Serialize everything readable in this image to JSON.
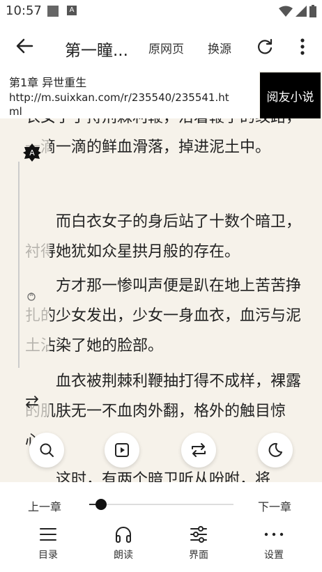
{
  "status": {
    "time": "10:57",
    "a_icon": "A"
  },
  "appbar": {
    "title": "第一瞳...",
    "original_page": "原网页",
    "change_source": "换源"
  },
  "info": {
    "chapter": "第1章 异世重生",
    "url": "http://m.suixkan.com/r/235540/235541.html",
    "source_name": "阅友小说"
  },
  "reader": {
    "paragraphs": [
      "衣女子手持荆棘利鞭，沿着鞭子的纹路，一滴一滴的鲜血滑落，掉进泥土中。",
      "　　而白衣女子的身后站了十数个暗卫，衬得她犹如众星拱月般的存在。",
      "　　方才那一惨叫声便是趴在地上苦苦挣扎的少女发出，少女一身血衣，血污与泥土沾染了她的脸部。",
      "　　血衣被荆棘利鞭抽打得不成样，裸露的肌肤无一不血肉外翻，格外的触目惊心。",
      "　　这时，有两个暗卫听从吩咐，将"
    ]
  },
  "side": {
    "icon_big": "A",
    "icon_small": "A"
  },
  "fabs": [
    "search-icon",
    "autoplay-icon",
    "replace-icon",
    "night-mode-icon"
  ],
  "bottom": {
    "prev_chapter": "上一章",
    "next_chapter": "下一章",
    "progress": 0.08,
    "nav": [
      {
        "label": "目录",
        "icon": "catalog-icon"
      },
      {
        "label": "朗读",
        "icon": "headphones-icon"
      },
      {
        "label": "界面",
        "icon": "sliders-icon"
      },
      {
        "label": "设置",
        "icon": "more-dots-icon"
      }
    ]
  }
}
